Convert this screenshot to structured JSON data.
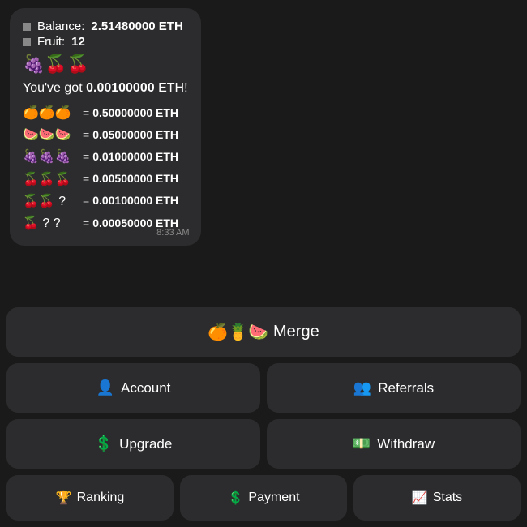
{
  "message": {
    "balance_label": "Balance:",
    "balance_value": "2.51480000 ETH",
    "fruit_label": "Fruit:",
    "fruit_value": "12",
    "fruits_display": "🍇🍒🍒",
    "got_text": "You've got ",
    "got_value": "0.00100000",
    "got_suffix": " ETH!",
    "values": [
      {
        "emojis": "🍊🍊🍊",
        "eth": "0.50000000 ETH"
      },
      {
        "emojis": "🍉🍉🍉",
        "eth": "0.05000000 ETH"
      },
      {
        "emojis": "🍇🍇🍇",
        "eth": "0.01000000 ETH"
      },
      {
        "emojis": "🍒🍒🍒",
        "eth": "0.00500000 ETH"
      },
      {
        "emojis": "🍒🍒  ?",
        "eth": "0.00100000 ETH"
      },
      {
        "emojis": "🍒  ?  ?",
        "eth": "0.00050000 ETH"
      }
    ],
    "timestamp": "8:33 AM"
  },
  "buttons": {
    "merge_label": "Merge",
    "merge_icon": "🍊🍍🍉",
    "account_label": "Account",
    "account_icon": "👤",
    "referrals_label": "Referrals",
    "referrals_icon": "👥",
    "upgrade_label": "Upgrade",
    "upgrade_icon": "$",
    "withdraw_label": "Withdraw",
    "withdraw_icon": "💵",
    "ranking_label": "Ranking",
    "ranking_icon": "🏆",
    "payment_label": "Payment",
    "payment_icon": "$",
    "stats_label": "Stats",
    "stats_icon": "📈"
  }
}
